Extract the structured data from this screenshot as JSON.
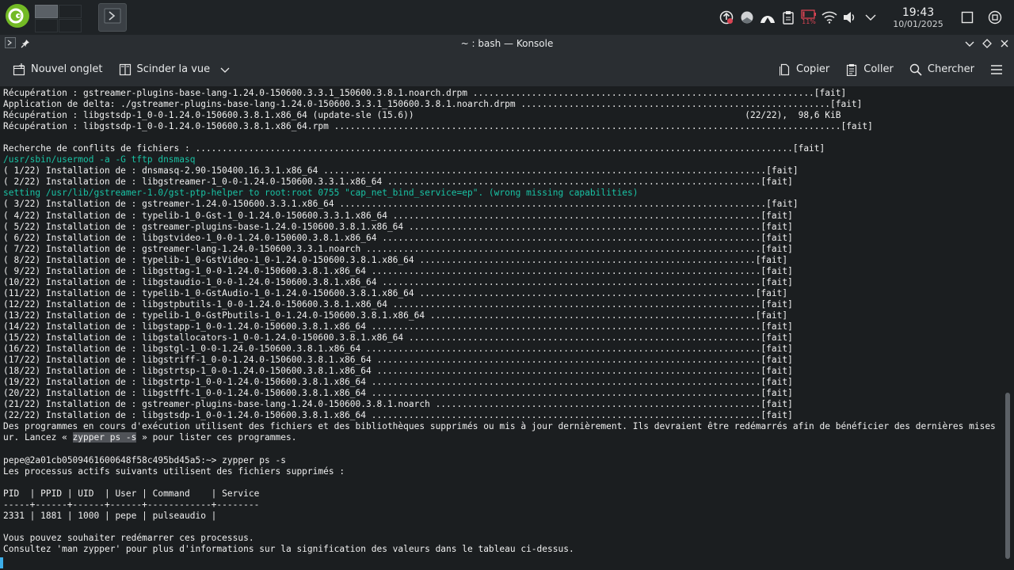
{
  "panel": {
    "clock_time": "19:43",
    "clock_date": "10/01/2025",
    "battery_label": "11%"
  },
  "window": {
    "title": "~ : bash — Konsole"
  },
  "toolbar": {
    "new_tab": "Nouvel onglet",
    "split_view": "Scinder la vue",
    "copy": "Copier",
    "paste": "Coller",
    "search": "Chercher"
  },
  "terminal": {
    "lines": [
      {
        "t": "Récupération : gstreamer-plugins-base-lang-1.24.0-150600.3.3.1_150600.3.8.1.noarch.drpm ................................................................[fait]"
      },
      {
        "t": "Application de delta: ./gstreamer-plugins-base-lang-1.24.0-150600.3.3.1_150600.3.8.1.noarch.drpm ..........................................................[fait]"
      },
      {
        "t": "Récupération : libgstsdp-1_0-0-1.24.0-150600.3.8.1.x86_64 (update-sle (15.6))                                                              (22/22),  98,6 KiB"
      },
      {
        "t": "Récupération : libgstsdp-1_0-0-1.24.0-150600.3.8.1.x86_64.rpm ...............................................................................................[fait]"
      },
      {
        "t": ""
      },
      {
        "t": "Recherche de conflits de fichiers : ................................................................................................................[fait]"
      },
      {
        "t": "/usr/sbin/usermod -a -G tftp dnsmasq",
        "c": "green"
      },
      {
        "t": "( 1/22) Installation de : dnsmasq-2.90-150400.16.3.1.x86_64 ...................................................................................[fait]"
      },
      {
        "t": "( 2/22) Installation de : libgstreamer-1_0-0-1.24.0-150600.3.3.1.x86_64 ......................................................................[fait]"
      },
      {
        "t": "setting /usr/lib/gstreamer-1.0/gst-ptp-helper to root:root 0755 \"cap_net_bind_service=ep\". (wrong missing capabilities)",
        "c": "green"
      },
      {
        "t": "( 3/22) Installation de : gstreamer-1.24.0-150600.3.3.1.x86_64 ................................................................................[fait]"
      },
      {
        "t": "( 4/22) Installation de : typelib-1_0-Gst-1_0-1.24.0-150600.3.3.1.x86_64 .....................................................................[fait]"
      },
      {
        "t": "( 5/22) Installation de : gstreamer-plugins-base-1.24.0-150600.3.8.1.x86_64 ..................................................................[fait]"
      },
      {
        "t": "( 6/22) Installation de : libgstvideo-1_0-0-1.24.0-150600.3.8.1.x86_64 .......................................................................[fait]"
      },
      {
        "t": "( 7/22) Installation de : gstreamer-lang-1.24.0-150600.3.3.1.noarch ..........................................................................[fait]"
      },
      {
        "t": "( 8/22) Installation de : typelib-1_0-GstVideo-1_0-1.24.0-150600.3.8.1.x86_64 ...............................................................[fait]"
      },
      {
        "t": "( 9/22) Installation de : libgsttag-1_0-0-1.24.0-150600.3.8.1.x86_64 .........................................................................[fait]"
      },
      {
        "t": "(10/22) Installation de : libgstaudio-1_0-0-1.24.0-150600.3.8.1.x86_64 .......................................................................[fait]"
      },
      {
        "t": "(11/22) Installation de : typelib-1_0-GstAudio-1_0-1.24.0-150600.3.8.1.x86_64 ...............................................................[fait]"
      },
      {
        "t": "(12/22) Installation de : libgstpbutils-1_0-0-1.24.0-150600.3.8.1.x86_64 .....................................................................[fait]"
      },
      {
        "t": "(13/22) Installation de : typelib-1_0-GstPbutils-1_0-1.24.0-150600.3.8.1.x86_64 .............................................................[fait]"
      },
      {
        "t": "(14/22) Installation de : libgstapp-1_0-0-1.24.0-150600.3.8.1.x86_64 .........................................................................[fait]"
      },
      {
        "t": "(15/22) Installation de : libgstallocators-1_0-0-1.24.0-150600.3.8.1.x86_64 ..................................................................[fait]"
      },
      {
        "t": "(16/22) Installation de : libgstgl-1_0-0-1.24.0-150600.3.8.1.x86_64 ..........................................................................[fait]"
      },
      {
        "t": "(17/22) Installation de : libgstriff-1_0-0-1.24.0-150600.3.8.1.x86_64 ........................................................................[fait]"
      },
      {
        "t": "(18/22) Installation de : libgstrtsp-1_0-0-1.24.0-150600.3.8.1.x86_64 ........................................................................[fait]"
      },
      {
        "t": "(19/22) Installation de : libgstrtp-1_0-0-1.24.0-150600.3.8.1.x86_64 .........................................................................[fait]"
      },
      {
        "t": "(20/22) Installation de : libgstfft-1_0-0-1.24.0-150600.3.8.1.x86_64 .........................................................................[fait]"
      },
      {
        "t": "(21/22) Installation de : gstreamer-plugins-base-lang-1.24.0-150600.3.8.1.noarch .............................................................[fait]"
      },
      {
        "t": "(22/22) Installation de : libgstsdp-1_0-0-1.24.0-150600.3.8.1.x86_64 .........................................................................[fait]"
      },
      {
        "t": "Des programmes en cours d'exécution utilisent des fichiers et des bibliothèques supprimés ou mis à jour dernièrement. Ils devraient être redémarrés afin de bénéficier des dernières mises à jo"
      },
      {
        "pre": "ur. Lancez « ",
        "hl": "zypper ps -s",
        "post": " » pour lister ces programmes."
      },
      {
        "t": ""
      },
      {
        "t": "pepe@2a01cb0509461600648f58c495bd45a5:~> zypper ps -s"
      },
      {
        "t": "Les processus actifs suivants utilisent des fichiers supprimés :"
      },
      {
        "t": ""
      },
      {
        "t": "PID  | PPID | UID  | User | Command    | Service"
      },
      {
        "t": "-----+------+------+------+------------+--------"
      },
      {
        "t": "2331 | 1881 | 1000 | pepe | pulseaudio |"
      },
      {
        "t": ""
      },
      {
        "t": "Vous pouvez souhaiter redémarrer ces processus."
      },
      {
        "t": "Consultez 'man zypper' pour plus d'informations sur la signification des valeurs dans le tableau ci-dessus."
      }
    ]
  }
}
